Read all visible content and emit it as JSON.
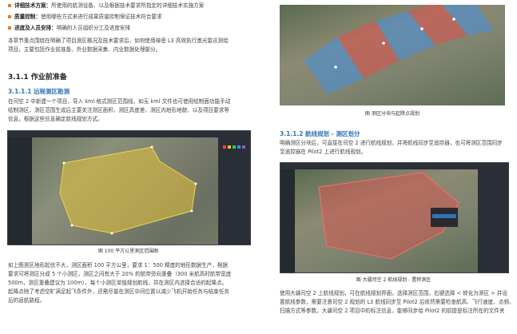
{
  "left": {
    "bullets": [
      {
        "title": "详细技术方案：",
        "text": "所使用的航测设备、以及根据技术要求所指定的详细技术实施方案"
      },
      {
        "title": "质量控制：",
        "text": "使用哪些方式来进行成果质量控制保证技术符合要求"
      },
      {
        "title": "进度及人员安排：",
        "text": "明确的人员组织分工及进度安排"
      }
    ],
    "intro": [
      "本章节重点围绕在明确了项目测区概况及技术要求后，如何使用禅思 L3 高效执行激光雷达测绘",
      "项目，主要包括作业前准备、外业数据采集、内业数据处理部分。"
    ],
    "section_title": "3.1.1 作业前准备",
    "subsection_title": "3.1.1.1 远程测区勘测",
    "subsection_body": [
      "在司空 2 中新建一个项目，导入 kml 格式测区范围线，如无 kml 文件也可使用绘制面功能手动",
      "绘制测区，测区范围生成后主要关注测区面积、测区高度差、测区内地形地貌、以及项目要求等",
      "信息，根据这些信息确定航线规划方式。"
    ],
    "figure_caption": "图 100 平方公里测区范围图",
    "body_after": [
      "如上图测区地形起伏不大，测区面积 100 平方公里，要求 1：500 精度的地形数据生产，根据",
      "要求可将测区分成 5 个小测区，测区之间有大于 20% 的航带旁向重叠（300 米航高时航带宽度",
      "500m，测区重叠建议为 100m），每个小测区单独规划航线，并在测区内选择合适的起降点。",
      "起降点除了考虑空旷满足起飞条件外，还需尽量在测区中间位置以减少飞机开始任务与结束任务",
      "后的返航路程。"
    ]
  },
  "right": {
    "figure1_caption": "图 测区分块与起降点规划",
    "subsection_title": "3.1.1.2 航线规划 - 测区划分",
    "subsection_body": [
      "明确测区分块后，可直接在司空 2 进行航线规划，并将航线同步至遥控器，也可将测区范围同步",
      "至遥控器在 Pilot2 上进行航线规划。"
    ],
    "figure2_caption": "图 大疆司空 2 航线规划 - 置转测区",
    "body_after": [
      "使用大疆司空 2 上航线规划，可在航线规划界面，选择测区范围，右键选择 < 转化为测区 > 并设",
      "置航线参数，需要注意司空 2 规划的 L3 航线同步至 Pilot2 后依然需要检查航高、飞行速度、点频、",
      "扫描方式等参数。大疆司空 2 项目中的标注信息，能够同步给 Pilot2 的前提是标注所在的文件夹"
    ]
  },
  "colors": {
    "accent": "#e67e22",
    "heading_blue": "#2e75b6",
    "yellow_area": "#e3c33a",
    "red_area": "#d9534f",
    "blue_area": "#4a90d9"
  }
}
